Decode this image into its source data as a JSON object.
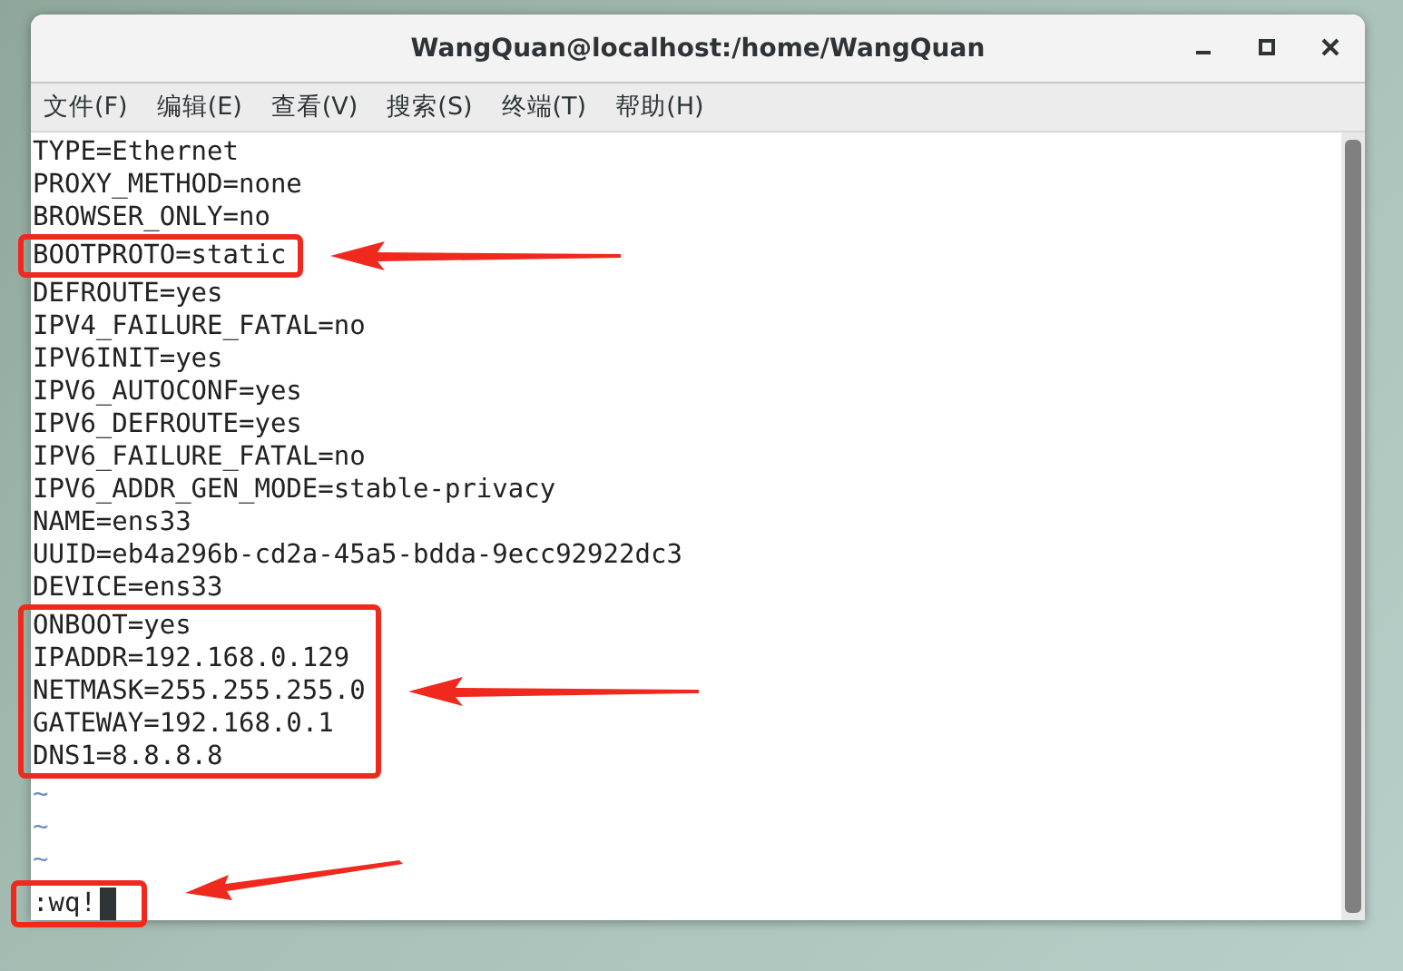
{
  "window": {
    "title": "WangQuan@localhost:/home/WangQuan"
  },
  "menu": [
    {
      "label": "文件(F)"
    },
    {
      "label": "编辑(E)"
    },
    {
      "label": "查看(V)"
    },
    {
      "label": "搜索(S)"
    },
    {
      "label": "终端(T)"
    },
    {
      "label": "帮助(H)"
    }
  ],
  "blocks": [
    {
      "annotated": false,
      "lines": [
        "TYPE=Ethernet",
        "PROXY_METHOD=none",
        "BROWSER_ONLY=no"
      ]
    },
    {
      "annotated": true,
      "lines": [
        "BOOTPROTO=static"
      ]
    },
    {
      "annotated": false,
      "lines": [
        "DEFROUTE=yes",
        "IPV4_FAILURE_FATAL=no",
        "IPV6INIT=yes",
        "IPV6_AUTOCONF=yes",
        "IPV6_DEFROUTE=yes",
        "IPV6_FAILURE_FATAL=no",
        "IPV6_ADDR_GEN_MODE=stable-privacy",
        "NAME=ens33",
        "UUID=eb4a296b-cd2a-45a5-bdda-9ecc92922dc3",
        "DEVICE=ens33"
      ]
    },
    {
      "annotated": true,
      "lines": [
        "ONBOOT=yes",
        "IPADDR=192.168.0.129",
        "NETMASK=255.255.255.0",
        "GATEWAY=192.168.0.1",
        "DNS1=8.8.8.8"
      ]
    }
  ],
  "empty_lines": [
    "~",
    "~",
    "~"
  ],
  "command": {
    "text": ":wq!",
    "annotated": true
  }
}
